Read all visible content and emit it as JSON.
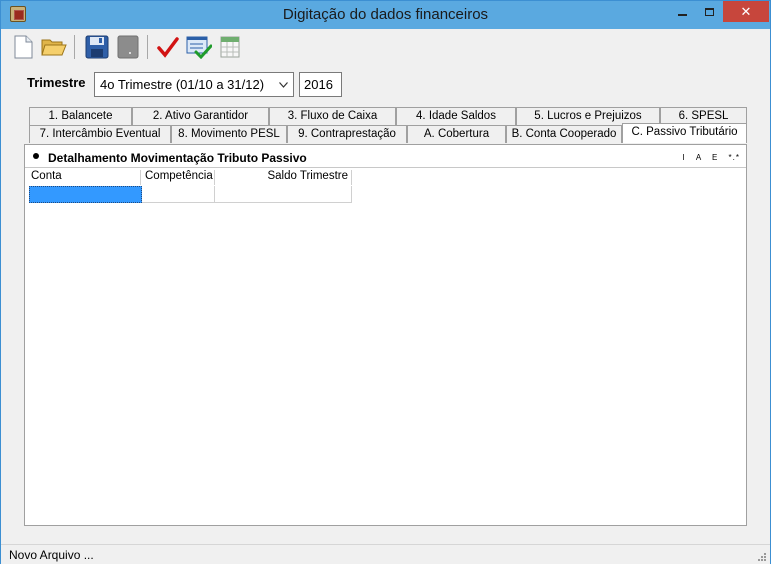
{
  "window": {
    "title": "Digitação do dados financeiros"
  },
  "toolbar": {
    "buttons": [
      {
        "name": "new-file",
        "icon": "new-document-icon"
      },
      {
        "name": "open-file",
        "icon": "folder-open-icon"
      },
      {
        "name": "save",
        "icon": "floppy-disk-icon"
      },
      {
        "name": "disabled-save",
        "icon": "gray-document-icon"
      },
      {
        "name": "validate",
        "icon": "check-mark-icon"
      },
      {
        "name": "validate-all",
        "icon": "check-list-icon"
      },
      {
        "name": "grid",
        "icon": "spreadsheet-icon"
      }
    ]
  },
  "filters": {
    "trimestre_label": "Trimestre",
    "trimestre_value": "4o Trimestre (01/10 a 31/12)",
    "year_value": "2016"
  },
  "tabs": {
    "row_top": [
      {
        "label": "1. Balancete"
      },
      {
        "label": "2. Ativo Garantidor"
      },
      {
        "label": "3. Fluxo de Caixa"
      },
      {
        "label": "4. Idade Saldos"
      },
      {
        "label": "5. Lucros e Prejuizos"
      },
      {
        "label": "6. SPESL"
      }
    ],
    "row_bottom": [
      {
        "label": "7. Intercâmbio Eventual"
      },
      {
        "label": "8. Movimento PESL"
      },
      {
        "label": "9. Contraprestação"
      },
      {
        "label": "A. Cobertura"
      },
      {
        "label": "B. Conta Cooperado"
      },
      {
        "label": "C. Passivo Tributário"
      }
    ],
    "active": "C. Passivo Tributário"
  },
  "section": {
    "title": "Detalhamento Movimentação Tributo Passivo",
    "tools": [
      "I",
      "A",
      "E",
      "*.*"
    ]
  },
  "grid": {
    "columns": [
      "Conta",
      "Competência",
      "Saldo Trimestre"
    ]
  },
  "status": {
    "text": "Novo Arquivo ..."
  },
  "colors": {
    "titlebar": "#5aa9e0",
    "close_button": "#c7463c",
    "selection": "#3399ff"
  }
}
